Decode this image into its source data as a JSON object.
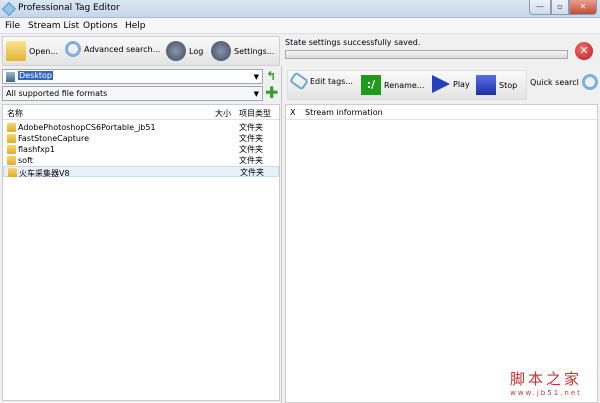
{
  "window": {
    "title": "Professional Tag Editor",
    "minimize": "—",
    "maximize": "▫",
    "close": "✕"
  },
  "menu": [
    "File",
    "Stream List",
    "Options",
    "Help"
  ],
  "toolbar": {
    "open": "Open...",
    "advanced_search": "Advanced search...",
    "log": "Log",
    "settings": "Settings..."
  },
  "status": {
    "message": "State settings successfully saved.",
    "progress": 0
  },
  "location": {
    "value": "Desktop",
    "filter": "All supported file formats"
  },
  "file_list": {
    "columns": [
      "名称",
      "大小",
      "项目类型"
    ],
    "rows": [
      {
        "name": "AdobePhotoshopCS6Portable_jb51",
        "type": "文件夹"
      },
      {
        "name": "FastStoneCapture",
        "type": "文件夹"
      },
      {
        "name": "flashfxp1",
        "type": "文件夹"
      },
      {
        "name": "soft",
        "type": "文件夹"
      },
      {
        "name": "火车采集器V8",
        "type": "文件夹"
      }
    ]
  },
  "stream_toolbar": {
    "edit_tags": "Edit tags...",
    "rename": "Rename...",
    "rename_icon_text": ":/",
    "play": "Play",
    "stop": "Stop",
    "quick_search": "Quick searcl"
  },
  "stream_table": {
    "columns": [
      "X",
      "Stream information"
    ]
  },
  "watermark": {
    "cn": "脚本之家",
    "url": "www.jb51.net"
  }
}
